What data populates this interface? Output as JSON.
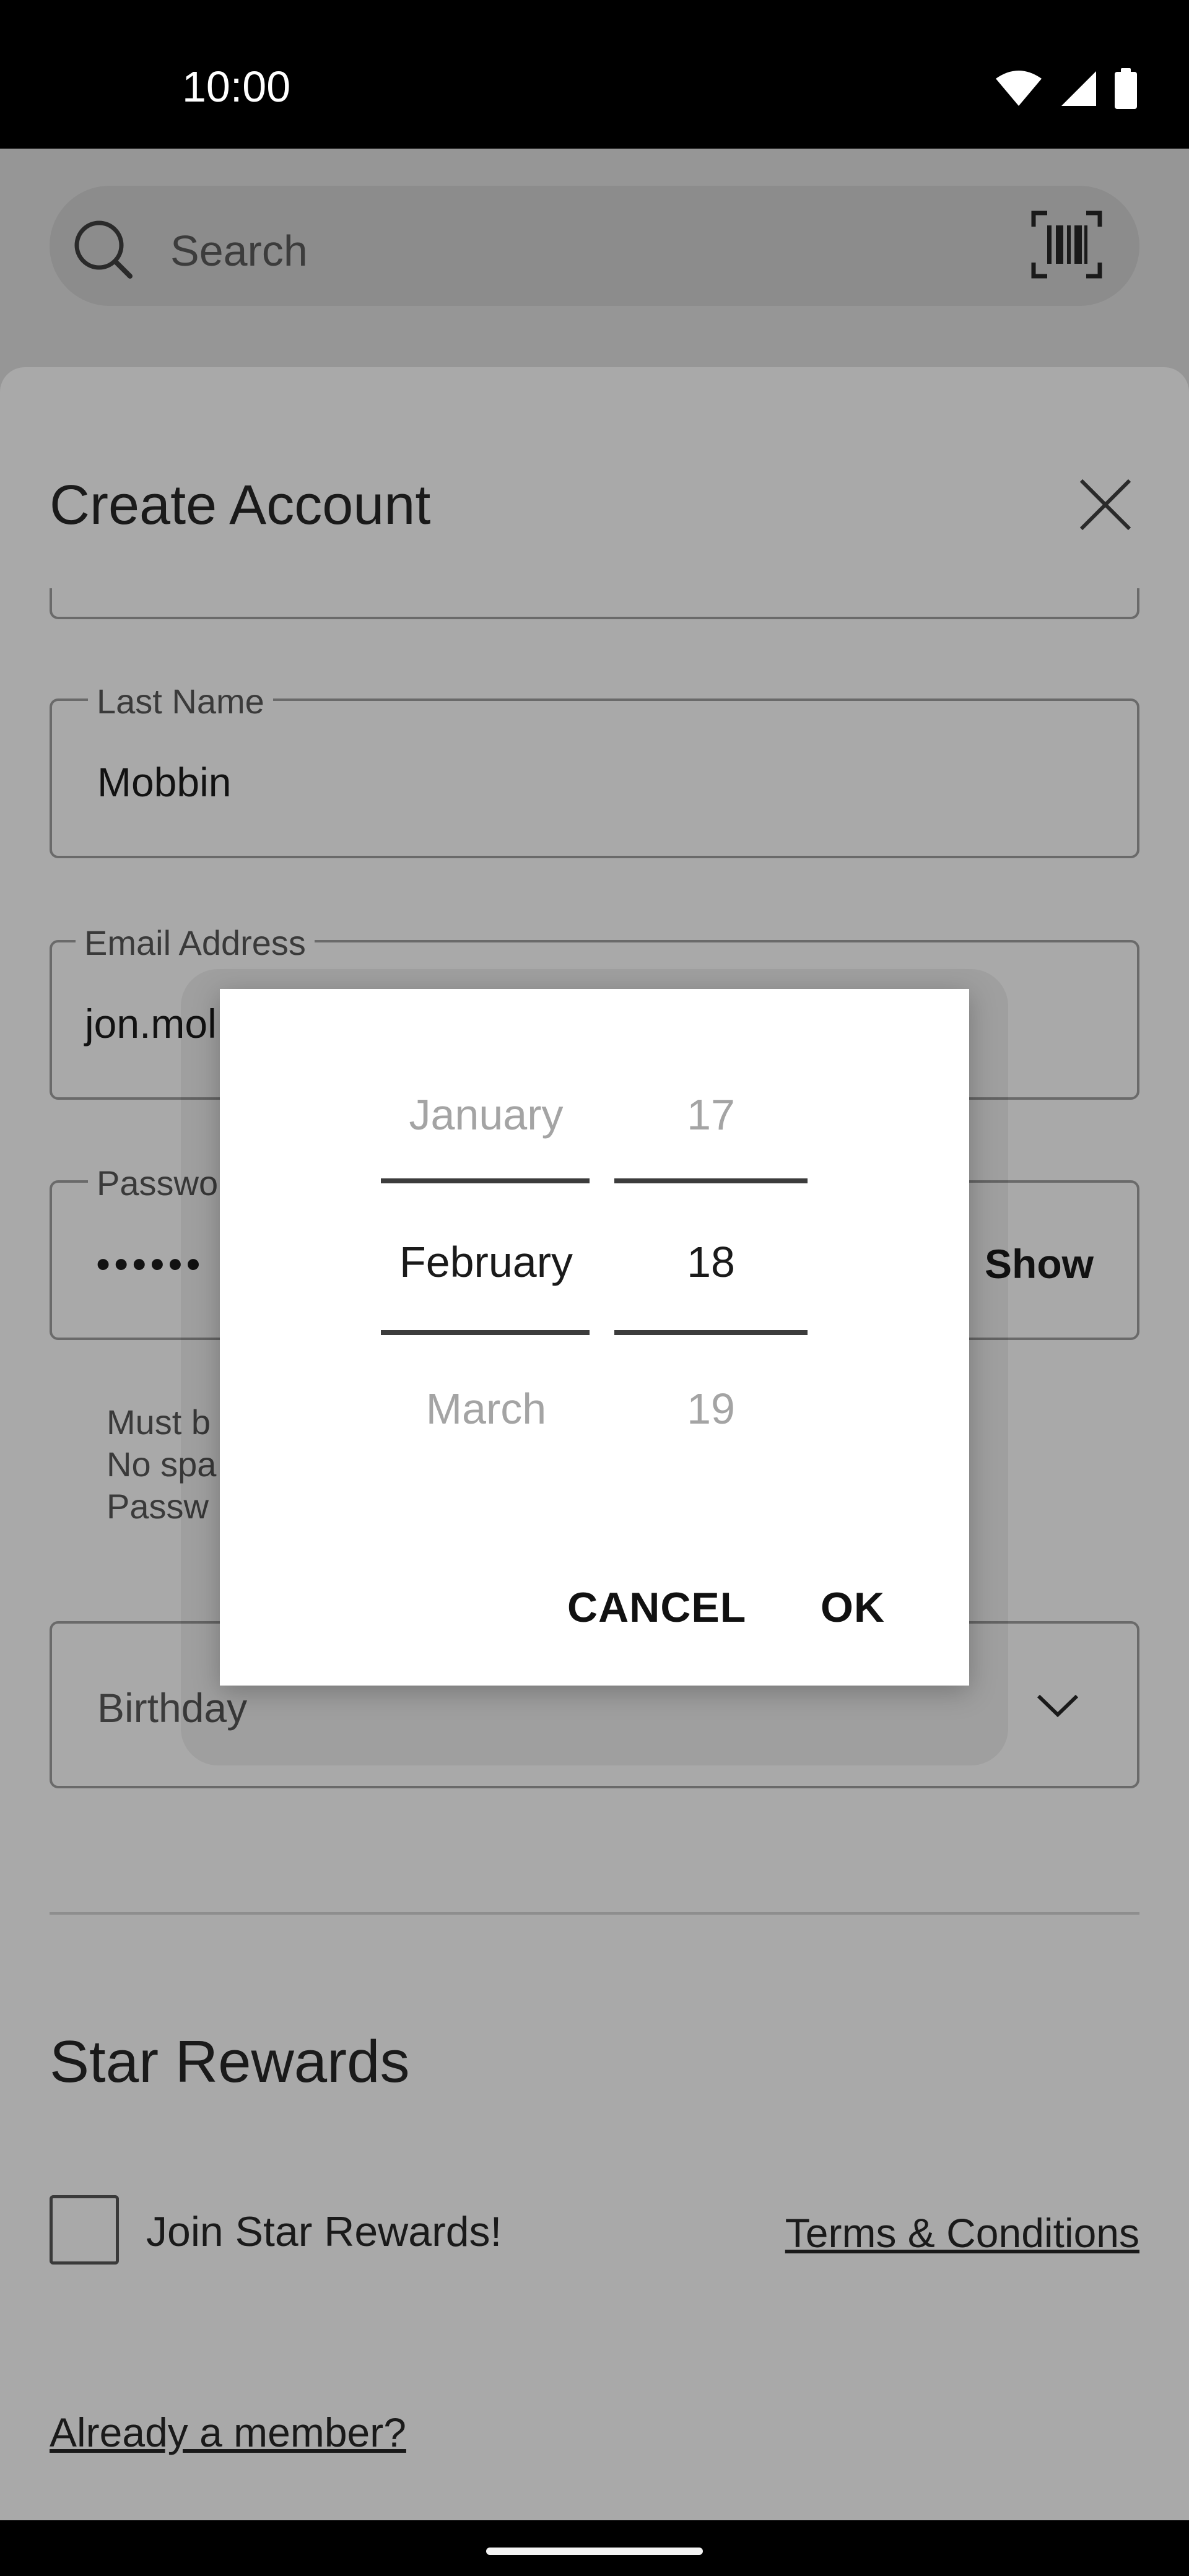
{
  "status_bar": {
    "time": "10:00"
  },
  "search": {
    "placeholder": "Search"
  },
  "sheet": {
    "title": "Create Account",
    "last_name": {
      "label": "Last Name",
      "value": "Mobbin"
    },
    "email": {
      "label": "Email Address",
      "value": "jon.mol"
    },
    "password": {
      "label": "Passwo",
      "value": "••••••",
      "show_label": "Show"
    },
    "password_rules": [
      "Must b",
      "No spa",
      "Passw"
    ],
    "birthday": {
      "placeholder": "Birthday"
    }
  },
  "rewards": {
    "title": "Star Rewards",
    "checkbox_label": "Join Star Rewards!",
    "terms_link": "Terms & Conditions",
    "member_link": "Already a member?"
  },
  "date_picker": {
    "months": {
      "prev": "January",
      "selected": "February",
      "next": "March"
    },
    "days": {
      "prev": "17",
      "selected": "18",
      "next": "19"
    },
    "cancel_label": "CANCEL",
    "ok_label": "OK"
  }
}
